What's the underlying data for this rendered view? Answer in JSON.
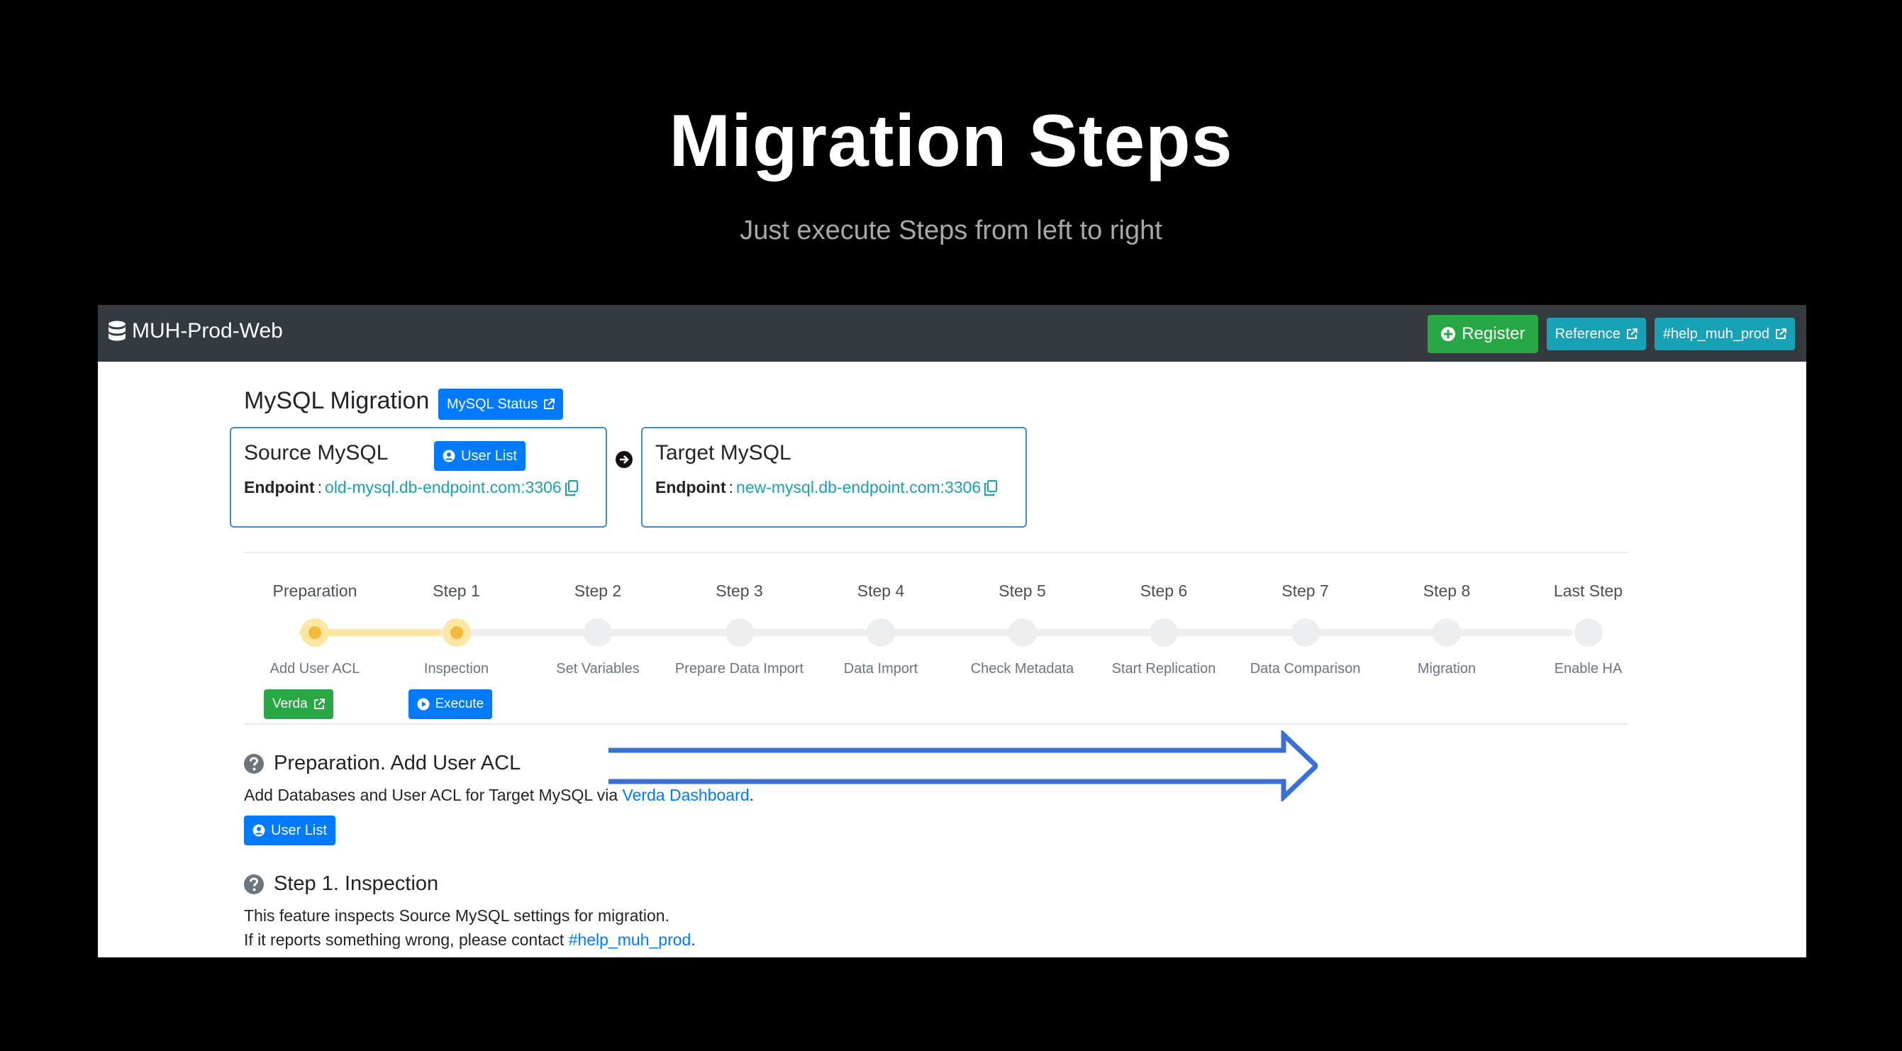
{
  "slide": {
    "title": "Migration Steps",
    "subtitle": "Just execute Steps from left to right"
  },
  "navbar": {
    "brand": "MUH-Prod-Web",
    "register_label": "Register",
    "reference_label": "Reference",
    "help_label": "#help_muh_prod",
    "colors": {
      "bg": "#343a40",
      "register": "#28a745",
      "info": "#17a2b8"
    }
  },
  "page": {
    "title": "MySQL Migration",
    "status_button": "MySQL Status"
  },
  "source": {
    "title": "Source MySQL",
    "user_list": "User List",
    "endpoint_label": "Endpoint",
    "endpoint": "old-mysql.db-endpoint.com:3306"
  },
  "target": {
    "title": "Target MySQL",
    "endpoint_label": "Endpoint",
    "endpoint": "new-mysql.db-endpoint.com:3306"
  },
  "steps": [
    {
      "label": "Preparation",
      "desc": "Add User ACL",
      "state": "active",
      "button": "Verda"
    },
    {
      "label": "Step 1",
      "desc": "Inspection",
      "state": "active",
      "button": "Execute"
    },
    {
      "label": "Step 2",
      "desc": "Set Variables",
      "state": "pending"
    },
    {
      "label": "Step 3",
      "desc": "Prepare Data Import",
      "state": "pending"
    },
    {
      "label": "Step 4",
      "desc": "Data Import",
      "state": "pending"
    },
    {
      "label": "Step 5",
      "desc": "Check Metadata",
      "state": "pending"
    },
    {
      "label": "Step 6",
      "desc": "Start Replication",
      "state": "pending"
    },
    {
      "label": "Step 7",
      "desc": "Data Comparison",
      "state": "pending"
    },
    {
      "label": "Step 8",
      "desc": "Migration",
      "state": "pending"
    },
    {
      "label": "Last Step",
      "desc": "Enable HA",
      "state": "pending"
    }
  ],
  "prep_section": {
    "heading": "Preparation. Add User ACL",
    "text_before": "Add Databases and User ACL for Target MySQL via ",
    "link": "Verda Dashboard",
    "text_after": ".",
    "button": "User List"
  },
  "inspection_section": {
    "heading": "Step 1. Inspection",
    "line1": "This feature inspects Source MySQL settings for migration.",
    "line2_before": "If it reports something wrong, please contact ",
    "line2_link": "#help_muh_prod",
    "line2_after": "."
  },
  "colors": {
    "primary": "#007bff",
    "success": "#28a745",
    "active_step": "#f6b93b",
    "annotation_arrow": "#3a6fd8"
  }
}
